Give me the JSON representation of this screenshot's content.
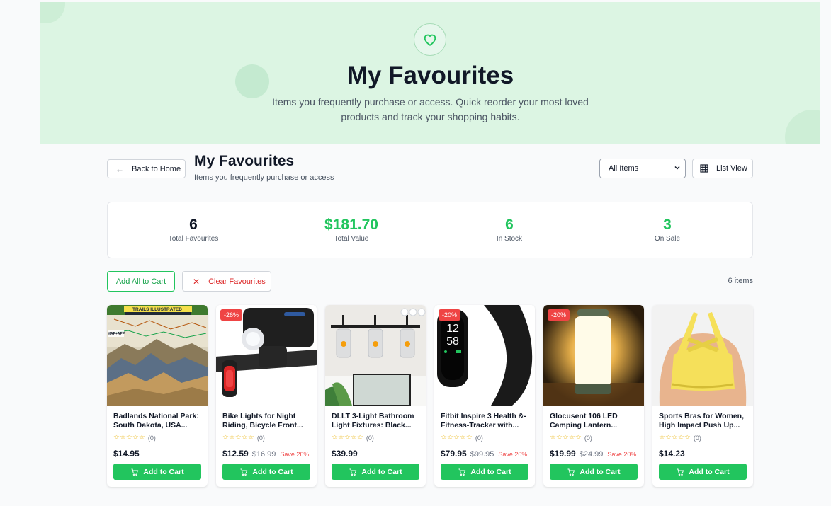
{
  "hero": {
    "title": "My Favourites",
    "subtitle": "Items you frequently purchase or access. Quick reorder your most loved products and track your shopping habits."
  },
  "header": {
    "back_label": "Back to Home",
    "title": "My Favourites",
    "subtitle": "Items you frequently purchase or access",
    "filter_value": "All Items",
    "view_label": "List View"
  },
  "stats": [
    {
      "value": "6",
      "label": "Total Favourites"
    },
    {
      "value": "$181.70",
      "label": "Total Value"
    },
    {
      "value": "6",
      "label": "In Stock"
    },
    {
      "value": "3",
      "label": "On Sale"
    }
  ],
  "actions": {
    "add_all_label": "Add All to Cart",
    "clear_label": "Clear Favourites",
    "count": "6 items"
  },
  "products": [
    {
      "name": "Badlands National Park: South Dakota, USA...",
      "rating_count": "(0)",
      "price": "$14.95",
      "old_price": "",
      "save": "",
      "badge": "",
      "cart_label": "Add to Cart"
    },
    {
      "name": "Bike Lights for Night Riding, Bicycle Front...",
      "rating_count": "(0)",
      "price": "$12.59",
      "old_price": "$16.99",
      "save": "Save 26%",
      "badge": "-26%",
      "cart_label": "Add to Cart"
    },
    {
      "name": "DLLT 3-Light Bathroom Light Fixtures: Black...",
      "rating_count": "(0)",
      "price": "$39.99",
      "old_price": "",
      "save": "",
      "badge": "",
      "cart_label": "Add to Cart"
    },
    {
      "name": "Fitbit Inspire 3 Health &-Fitness-Tracker with...",
      "rating_count": "(0)",
      "price": "$79.95",
      "old_price": "$99.95",
      "save": "Save 20%",
      "badge": "-20%",
      "cart_label": "Add to Cart"
    },
    {
      "name": "Glocusent 106 LED Camping Lantern...",
      "rating_count": "(0)",
      "price": "$19.99",
      "old_price": "$24.99",
      "save": "Save 20%",
      "badge": "-20%",
      "cart_label": "Add to Cart"
    },
    {
      "name": "Sports Bras for Women, High Impact Push Up...",
      "rating_count": "(0)",
      "price": "$14.23",
      "old_price": "",
      "save": "",
      "badge": "",
      "cart_label": "Add to Cart"
    }
  ],
  "map_image_text": [
    "TRAILS ILLUSTRATED",
    "MAP+APP"
  ],
  "colors": {
    "accent": "#22c55e",
    "danger": "#ef4444",
    "hero_bg": "#dcf5e3"
  }
}
